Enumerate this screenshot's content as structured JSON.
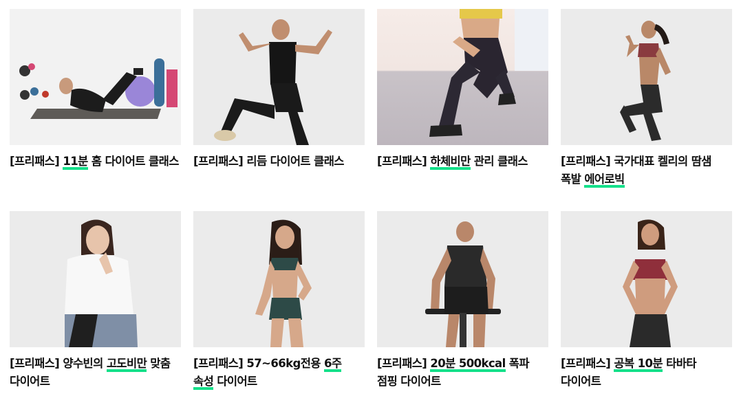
{
  "accent_color": "#14e08a",
  "classes": [
    {
      "thumbnail": "man-doing-crunches-on-mat-with-gym-ball",
      "prefix": "[프리패스] ",
      "pre": "",
      "highlight": "11분",
      "post": " 홈 다이어트 클래스"
    },
    {
      "thumbnail": "man-in-black-doing-rhythm-pose",
      "prefix": "[프리패스] ",
      "pre": "리듬 다이어트 클래스",
      "highlight": "",
      "post": ""
    },
    {
      "thumbnail": "woman-lunge-in-leggings",
      "prefix": "[프리패스] ",
      "pre": "",
      "highlight": "하체비만",
      "post": " 관리 클래스"
    },
    {
      "thumbnail": "woman-in-sports-bra-high-knee",
      "prefix": "[프리패스] ",
      "pre": "국가대표 켈리의 땀샘 폭발 ",
      "highlight": "에어로빅",
      "post": ""
    },
    {
      "thumbnail": "woman-in-white-shirt-sitting",
      "prefix": "[프리패스] ",
      "pre": "양수빈의 ",
      "highlight": "고도비만",
      "post": " 맞춤 다이어트"
    },
    {
      "thumbnail": "woman-in-green-sportswear-posing",
      "prefix": "[프리패스] ",
      "pre": "57~66kg전용 ",
      "highlight": "6주 속성",
      "post": " 다이어트"
    },
    {
      "thumbnail": "man-in-black-on-jump-stick",
      "prefix": "[프리패스] ",
      "pre": "",
      "highlight": "20분 500kcal",
      "post": " 폭파 점핑 다이어트"
    },
    {
      "thumbnail": "woman-in-red-sports-bra-posing",
      "prefix": "[프리패스] ",
      "pre": "",
      "highlight": "공복 10분",
      "post": " 타바타 다이어트"
    }
  ]
}
